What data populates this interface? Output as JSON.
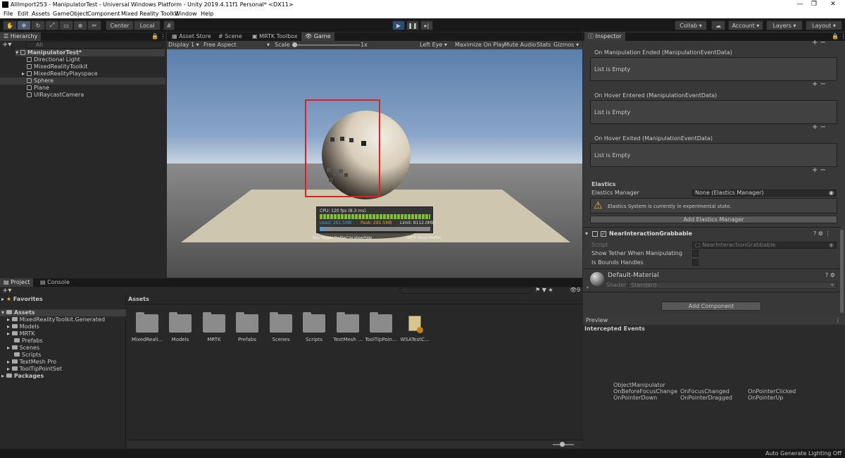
{
  "window": {
    "title": "AllImport253 - ManipulatorTest - Universal Windows Platform - Unity 2019.4.11f1 Personal* <DX11>",
    "controls": [
      "—",
      "❐",
      "✕"
    ]
  },
  "menu": [
    "File",
    "Edit",
    "Assets",
    "GameObject",
    "Component",
    "Mixed Reality Toolkit",
    "Window",
    "Help"
  ],
  "toolbar": {
    "pivot": "Center",
    "space": "Local",
    "collab": "Collab ▾",
    "account": "Account",
    "layers": "Layers",
    "layout": "Layout"
  },
  "hierarchy": {
    "tab": "Hierarchy",
    "search_placeholder": "All",
    "scene": "ManipulatorTest*",
    "items": [
      "Directional Light",
      "MixedRealityToolkit",
      "MixedRealityPlayspace",
      "Sphere",
      "Plane",
      "UIRaycastCamera"
    ]
  },
  "center_tabs": [
    "Asset Store",
    "Scene",
    "MRTK Toolbox",
    "Game"
  ],
  "game_bar": {
    "display": "Display 1",
    "aspect": "Free Aspect",
    "scale_label": "Scale",
    "scale_value": "1x",
    "eye": "Left Eye",
    "maximize": "Maximize On Play",
    "mute": "Mute Audio",
    "stats": "Stats",
    "gizmos": "Gizmos"
  },
  "profiler": {
    "cpu": "CPU: 120 fps (8.3 ms)",
    "used": "Used: 261.5MB",
    "peak": "Peak: 281.5MB",
    "limit": "Limit: 8112.0MB",
    "footer_left": "Say \"Toggle Profiler\" to show/hide",
    "footer_right": "MRTK Visual Profiler"
  },
  "inspector": {
    "tab": "Inspector",
    "events": [
      {
        "title": "On Manipulation Ended (ManipulationEventData)",
        "body": "List is Empty"
      },
      {
        "title": "On Hover Entered (ManipulationEventData)",
        "body": "List is Empty"
      },
      {
        "title": "On Hover Exited (ManipulationEventData)",
        "body": "List is Empty"
      }
    ],
    "elastics_header": "Elastics",
    "elastics_manager_label": "Elastics Manager",
    "elastics_manager_value": "None (Elastics Manager)",
    "elastics_warning": "Elastics System is currently in experimental state.",
    "add_elastics_button": "Add Elastics Manager",
    "component_name": "NearInteractionGrabbable",
    "script_label": "Script",
    "script_value": "NearInteractionGrabbable",
    "tether_label": "Show Tether When Manipulating",
    "bounds_label": "Is Bounds Handles",
    "material_name": "Default-Material",
    "shader_label": "Shader",
    "shader_value": "Standard",
    "add_component_button": "Add Component"
  },
  "preview": {
    "tab": "Preview",
    "section": "Intercepted Events",
    "object": "ObjectManipulator",
    "events": [
      "OnBeforeFocusChange",
      "OnFocusChanged",
      "OnPointerClicked",
      "OnPointerDown",
      "OnPointerDragged",
      "OnPointerUp"
    ]
  },
  "project": {
    "tabs": [
      "Project",
      "Console"
    ],
    "favorites": "Favorites",
    "assets_root": "Assets",
    "tree": [
      "MixedRealityToolkit.Generated",
      "Models",
      "MRTK",
      "Prefabs",
      "Scenes",
      "Scripts",
      "TextMesh Pro",
      "ToolTipPointSet"
    ],
    "packages": "Packages",
    "breadcrumb": "Assets",
    "hidden_count": "9",
    "assets": [
      "MixedReali...",
      "Models",
      "MRTK",
      "Prefabs",
      "Scenes",
      "Scripts",
      "TextMesh ...",
      "ToolTipPoin...",
      "WSATestC..."
    ]
  },
  "status": {
    "right": "Auto Generate Lighting Off"
  },
  "colors": {
    "accent_play": "#2b4d78",
    "selection_box": "#e02020",
    "profiler_bar": "#7fbf2a"
  }
}
